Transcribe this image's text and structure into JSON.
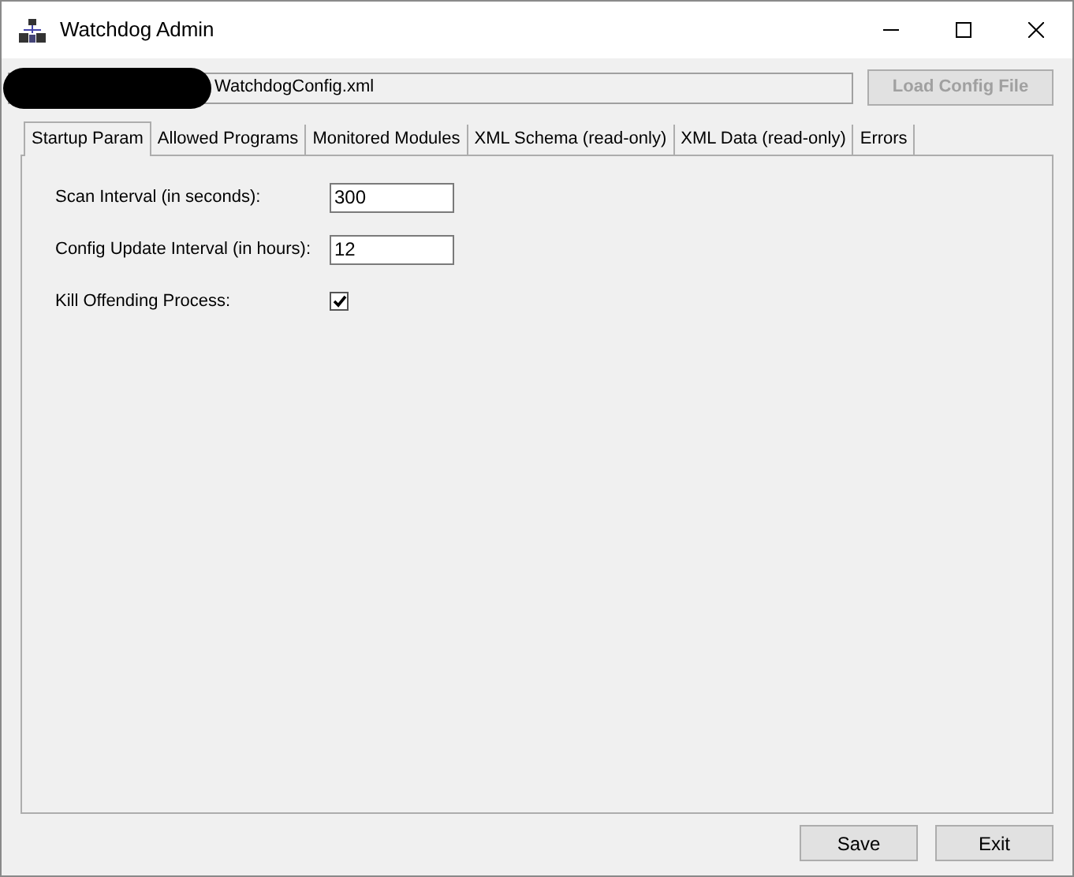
{
  "window": {
    "title": "Watchdog Admin"
  },
  "config_path": {
    "value": "WatchdogConfig.xml"
  },
  "load_button": {
    "label": "Load Config File",
    "disabled": true
  },
  "tabs": [
    {
      "label": "Startup Param",
      "selected": true
    },
    {
      "label": "Allowed Programs",
      "selected": false
    },
    {
      "label": "Monitored Modules",
      "selected": false
    },
    {
      "label": "XML Schema (read-only)",
      "selected": false
    },
    {
      "label": "XML Data (read-only)",
      "selected": false
    },
    {
      "label": "Errors",
      "selected": false
    }
  ],
  "fields": [
    {
      "kind": "text",
      "label": "Scan Interval (in seconds):",
      "value": "300"
    },
    {
      "kind": "text",
      "label": "Config Update Interval (in hours):",
      "value": "12"
    },
    {
      "kind": "checkbox",
      "label": "Kill Offending Process:",
      "checked": true
    }
  ],
  "buttons": [
    "Save",
    "Exit"
  ]
}
